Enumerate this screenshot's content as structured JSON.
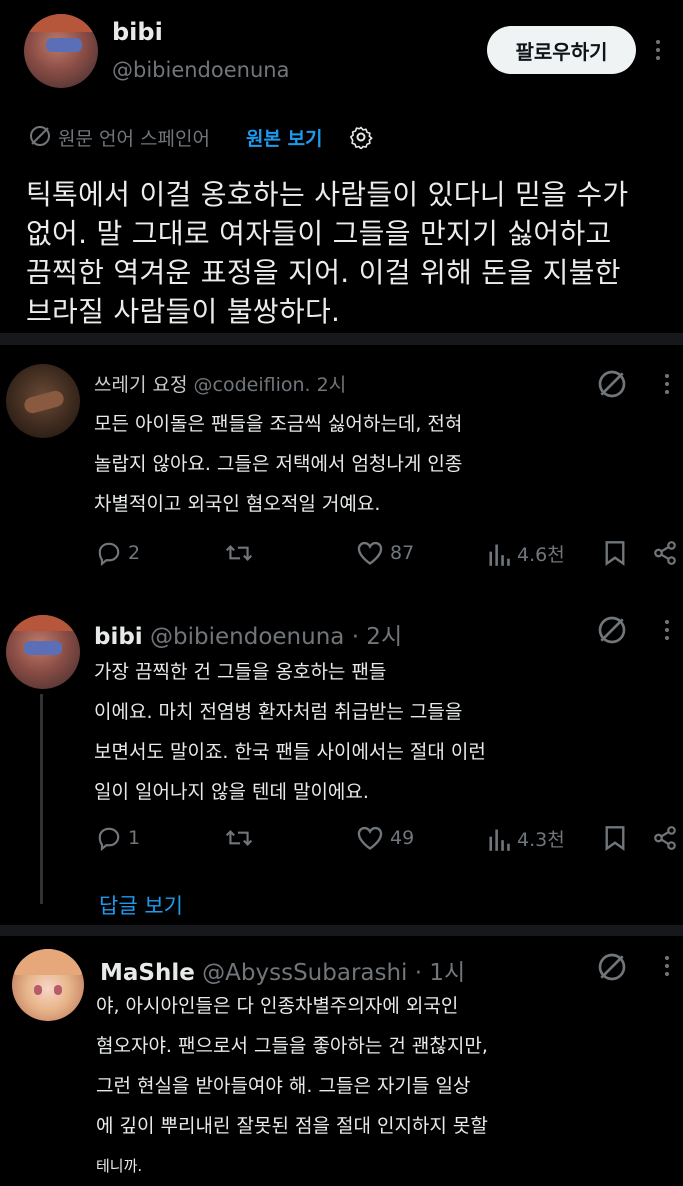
{
  "main_post": {
    "display_name": "bibi",
    "handle": "@bibiendoenuna",
    "follow_label": "팔로우하기",
    "translate_note": "원문 언어 스페인어",
    "view_original": "원본 보기",
    "lines": [
      "틱톡에서 이걸 옹호하는 사람들이 있다니 믿을 수가",
      "없어. 말 그대로 여자들이 그들을 만지기 싫어하고",
      "끔찍한 역겨운 표정을 지어. 이걸 위해 돈을 지불한",
      "브라질 사람들이 불쌍하다."
    ]
  },
  "replies": [
    {
      "display_name": "쓰레기 요정",
      "handle": "@codeiflion.",
      "time": "2시",
      "lines": [
        "모든 아이돌은 팬들을 조금씩 싫어하는데, 전혀",
        "놀랍지 않아요. 그들은 저택에서 엄청나게 인종",
        "차별적이고 외국인 혐오적일 거예요."
      ],
      "replies": "2",
      "likes": "87",
      "views": "4.6천"
    },
    {
      "display_name": "bibi",
      "handle": "@bibiendoenuna",
      "time": "· 2시",
      "lines": [
        "가장 끔찍한 건 그들을 옹호하는 팬들",
        "이에요. 마치 전염병 환자처럼 취급받는 그들을",
        "보면서도 말이죠. 한국 팬들 사이에서는 절대 이런",
        "일이 일어나지 않을 텐데 말이에요."
      ],
      "replies": "1",
      "likes": "49",
      "views": "4.3천",
      "show_replies": "답글 보기"
    },
    {
      "display_name": "MaShle",
      "handle": "@AbyssSubarashi",
      "time": "· 1시",
      "lines": [
        "야, 아시아인들은 다 인종차별주의자에 외국인",
        "혐오자야. 팬으로서 그들을 좋아하는 건 괜찮지만,",
        "그런 현실을 받아들여야 해. 그들은 자기들 일상",
        "에 깊이 뿌리내린 잘못된 점을 절대 인지하지 못할",
        "테니까."
      ]
    }
  ],
  "colors": {
    "background": "#000000",
    "text": "#e7e9ea",
    "muted": "#71767b",
    "accent": "#1d9bf0"
  }
}
